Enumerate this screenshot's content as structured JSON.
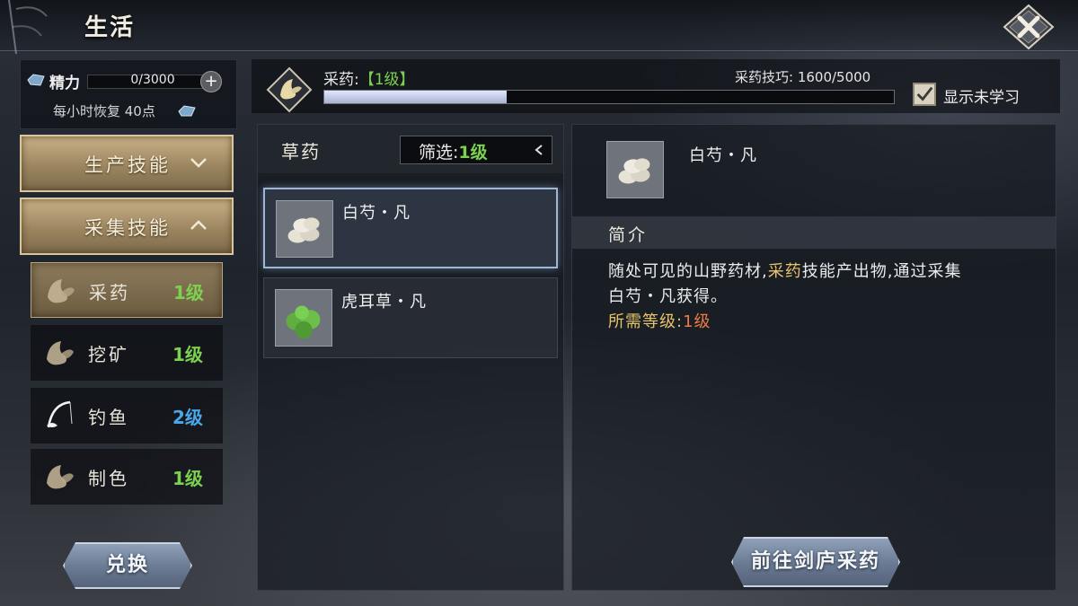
{
  "header": {
    "title": "生活",
    "close_icon": "close-x-icon"
  },
  "stamina": {
    "label": "精力",
    "value": "0/3000",
    "current": 0,
    "max": 3000,
    "plus_label": "+",
    "regen_text": "每小时恢复 40点"
  },
  "categories": [
    {
      "label": "生产技能",
      "expanded": false
    },
    {
      "label": "采集技能",
      "expanded": true
    }
  ],
  "skills": [
    {
      "name": "采药",
      "level": "1级",
      "level_color": "#7cd24e",
      "icon": "herb-leaf-icon",
      "active": true
    },
    {
      "name": "挖矿",
      "level": "1级",
      "level_color": "#7cd24e",
      "icon": "ore-leaf-icon",
      "active": false
    },
    {
      "name": "钓鱼",
      "level": "2级",
      "level_color": "#4aa8e8",
      "icon": "fishing-rod-icon",
      "active": false
    },
    {
      "name": "制色",
      "level": "1级",
      "level_color": "#7cd24e",
      "icon": "dye-leaf-icon",
      "active": false
    }
  ],
  "progress": {
    "skill_prefix": "采药:",
    "skill_level": "【1级】",
    "proficiency_text": "采药技巧: 1600/5000",
    "current": 1600,
    "max": 5000,
    "show_unlearned_label": "显示未学习",
    "show_unlearned_checked": true
  },
  "list": {
    "title": "草药",
    "filter_label": "筛选:",
    "filter_value": "1级",
    "items": [
      {
        "name": "白芍・凡",
        "icon": "white-peony-icon",
        "selected": true
      },
      {
        "name": "虎耳草・凡",
        "icon": "saxifrage-icon",
        "selected": false
      }
    ]
  },
  "detail": {
    "name": "白芍・凡",
    "intro_label": "简介",
    "desc_part1": "随处可见的山野药材,",
    "desc_highlight": "采药",
    "desc_part2": "技能产出物,通过采集",
    "desc_part3": "白芍・凡获得。",
    "req_label": "所需等级:",
    "req_value": "1级"
  },
  "buttons": {
    "exchange": "兑换",
    "goto": "前往剑庐采药"
  },
  "colors": {
    "green_level": "#7cd24e",
    "blue_level": "#4aa8e8",
    "highlight": "#e7c36a",
    "req_value": "#f07a43"
  }
}
